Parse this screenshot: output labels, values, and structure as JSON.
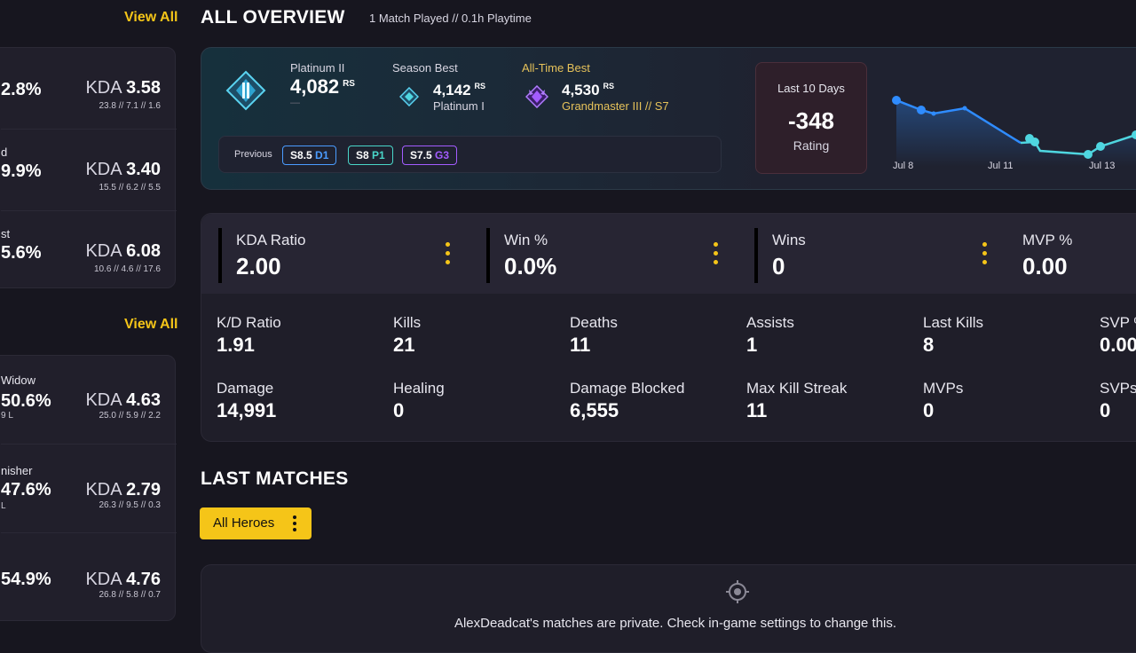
{
  "left_panel": {
    "view_all_1": "View All",
    "view_all_2": "View All",
    "roles": [
      {
        "name": "",
        "pct": "2.8%",
        "kda_label": "KDA",
        "kda": "3.58",
        "kda_sub": "23.8 // 7.1 // 1.6"
      },
      {
        "name": "d",
        "pct": "9.9%",
        "kda_label": "KDA",
        "kda": "3.40",
        "kda_sub": "15.5 // 6.2 // 5.5"
      },
      {
        "name": "st",
        "pct": "5.6%",
        "kda_label": "KDA",
        "kda": "6.08",
        "kda_sub": "10.6 // 4.6 // 17.6"
      }
    ],
    "heroes": [
      {
        "name": "Widow",
        "pct": "50.6%",
        "sub": "9 L",
        "kda_label": "KDA",
        "kda": "4.63",
        "kda_sub": "25.0 // 5.9 // 2.2"
      },
      {
        "name": "nisher",
        "pct": "47.6%",
        "sub": "L",
        "kda_label": "KDA",
        "kda": "2.79",
        "kda_sub": "26.3 // 9.5 // 0.3"
      },
      {
        "name": "",
        "pct": "54.9%",
        "sub": "",
        "kda_label": "KDA",
        "kda": "4.76",
        "kda_sub": "26.8 // 5.8 // 0.7"
      }
    ]
  },
  "overview": {
    "title": "ALL OVERVIEW",
    "subtitle": "1 Match Played // 0.1h Playtime"
  },
  "rank": {
    "current_label": "Platinum II",
    "current_value": "4,082",
    "rs": "RS",
    "current_sub": "—",
    "season_best_label": "Season Best",
    "season_best_value": "4,142",
    "season_best_rank": "Platinum I",
    "alltime_label": "All-Time Best",
    "alltime_value": "4,530",
    "alltime_rank": "Grandmaster III // S7",
    "previous_label": "Previous",
    "previous": [
      {
        "season": "S8.5",
        "tier": "D1",
        "color": "#4a9cff"
      },
      {
        "season": "S8",
        "tier": "P1",
        "color": "#49d6c9"
      },
      {
        "season": "S7.5",
        "tier": "G3",
        "color": "#a35cff"
      }
    ]
  },
  "last10": {
    "label": "Last 10 Days",
    "value": "-348",
    "sub": "Rating"
  },
  "trend": {
    "x_labels": [
      "Jul 8",
      "Jul 11",
      "Jul 13"
    ]
  },
  "top_stats": [
    {
      "label": "KDA Ratio",
      "value": "2.00"
    },
    {
      "label": "Win %",
      "value": "0.0%"
    },
    {
      "label": "Wins",
      "value": "0"
    },
    {
      "label": "MVP %",
      "value": "0.00"
    }
  ],
  "stats_row1": [
    {
      "label": "K/D Ratio",
      "value": "1.91"
    },
    {
      "label": "Kills",
      "value": "21"
    },
    {
      "label": "Deaths",
      "value": "11"
    },
    {
      "label": "Assists",
      "value": "1"
    },
    {
      "label": "Last Kills",
      "value": "8"
    },
    {
      "label": "SVP %",
      "value": "0.00"
    }
  ],
  "stats_row2": [
    {
      "label": "Damage",
      "value": "14,991"
    },
    {
      "label": "Healing",
      "value": "0"
    },
    {
      "label": "Damage Blocked",
      "value": "6,555"
    },
    {
      "label": "Max Kill Streak",
      "value": "11"
    },
    {
      "label": "MVPs",
      "value": "0"
    },
    {
      "label": "SVPs",
      "value": "0"
    }
  ],
  "last_matches": {
    "title": "LAST MATCHES",
    "filter_label": "All Heroes",
    "private_msg": "AlexDeadcat's matches are private. Check in-game settings to change this."
  },
  "colors": {
    "accent": "#f5c518",
    "background": "#17161f",
    "card": "#211f2b",
    "negative": "#3a1f28",
    "trend_line": "#2f8cff",
    "trend_line_2": "#4fd6e0"
  }
}
